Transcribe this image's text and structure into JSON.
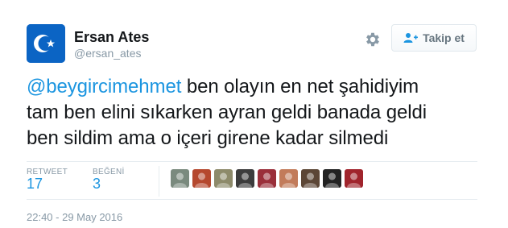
{
  "user": {
    "name": "Ersan Ates",
    "handle": "@ersan_ates"
  },
  "follow_button": {
    "label": "Takip et"
  },
  "tweet": {
    "mention": "@beygircimehmet",
    "line1_rest": " ben olayın en net şahidiyim",
    "line2": "tam ben elini sıkarken ayran geldi banada geldi",
    "line3": "ben sildim ama o içeri girene kadar silmedi"
  },
  "stats": {
    "retweet_label": "RETWEET",
    "retweet_count": "17",
    "like_label": "BEĞENİ",
    "like_count": "3"
  },
  "liker_avatars": [
    {
      "icon": "person-avatar-icon",
      "color": "#7a8a7e"
    },
    {
      "icon": "person-avatar-icon",
      "color": "#b5482e"
    },
    {
      "icon": "person-avatar-icon",
      "color": "#8d8a6a"
    },
    {
      "icon": "person-avatar-icon",
      "color": "#3c3c3c"
    },
    {
      "icon": "person-avatar-icon",
      "color": "#9a2f3a"
    },
    {
      "icon": "person-avatar-icon",
      "color": "#c27b5a"
    },
    {
      "icon": "person-avatar-icon",
      "color": "#5c4636"
    },
    {
      "icon": "person-avatar-icon",
      "color": "#222222"
    },
    {
      "icon": "person-avatar-icon",
      "color": "#a0242c"
    }
  ],
  "timestamp": "22:40 - 29 May 2016",
  "colors": {
    "link": "#1b95e0",
    "muted": "#8899a6",
    "avatar_bg": "#0b64c4"
  }
}
